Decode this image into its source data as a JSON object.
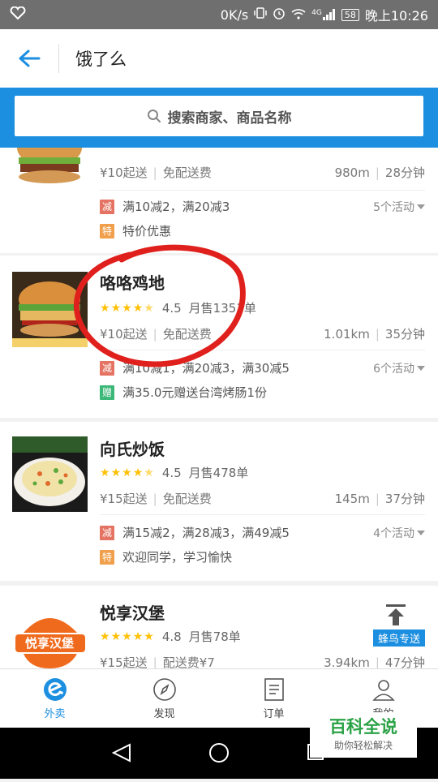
{
  "status_bar": {
    "speed": "0K/s",
    "network": "4G",
    "battery": "58",
    "time": "晚上10:26"
  },
  "header": {
    "title": "饿了么"
  },
  "search": {
    "placeholder": "搜索商家、商品名称"
  },
  "stores": [
    {
      "name": "",
      "min_order": "¥10起送",
      "delivery_fee": "免配送费",
      "distance": "980m",
      "eta": "28分钟",
      "promos": [
        {
          "badge": "减",
          "text": "满10减2，满20减3"
        },
        {
          "badge": "特",
          "text": "特价优惠"
        }
      ],
      "activities": "5个活动"
    },
    {
      "name": "咯咯鸡地",
      "rating": "4.5",
      "rating_value": 4.5,
      "sales": "月售1351单",
      "min_order": "¥10起送",
      "delivery_fee": "免配送费",
      "distance": "1.01km",
      "eta": "35分钟",
      "promos": [
        {
          "badge": "减",
          "text": "满10减1，满20减3，满30减5"
        },
        {
          "badge": "赠",
          "text": "满35.0元赠送台湾烤肠1份"
        }
      ],
      "activities": "6个活动"
    },
    {
      "name": "向氏炒饭",
      "rating": "4.5",
      "rating_value": 4.5,
      "sales": "月售478单",
      "min_order": "¥15起送",
      "delivery_fee": "免配送费",
      "distance": "145m",
      "eta": "37分钟",
      "promos": [
        {
          "badge": "减",
          "text": "满15减2，满28减3，满49减5"
        },
        {
          "badge": "特",
          "text": "欢迎同学，学习愉快"
        }
      ],
      "activities": "4个活动"
    },
    {
      "name": "悦享汉堡",
      "rating": "4.8",
      "rating_value": 4.8,
      "sales": "月售78单",
      "min_order": "¥15起送",
      "delivery_fee": "配送费¥7",
      "distance": "3.94km",
      "eta": "47分钟",
      "tag": "蜂鸟专送",
      "logo_text": "悦享汉堡"
    }
  ],
  "tabs": [
    {
      "label": "外卖",
      "icon": "eleme-logo-icon",
      "active": true
    },
    {
      "label": "发现",
      "icon": "compass-icon",
      "active": false
    },
    {
      "label": "订单",
      "icon": "order-list-icon",
      "active": false
    },
    {
      "label": "我的",
      "icon": "profile-icon",
      "active": false
    }
  ],
  "watermark": {
    "title": "百科全说",
    "subtitle": "助你轻松解决"
  },
  "colors": {
    "brand": "#1d8fe1",
    "star": "#ffc107",
    "badge_red": "#e57363",
    "badge_orange": "#f0a04c",
    "badge_green": "#3cb878",
    "annotation": "#e0201c"
  }
}
